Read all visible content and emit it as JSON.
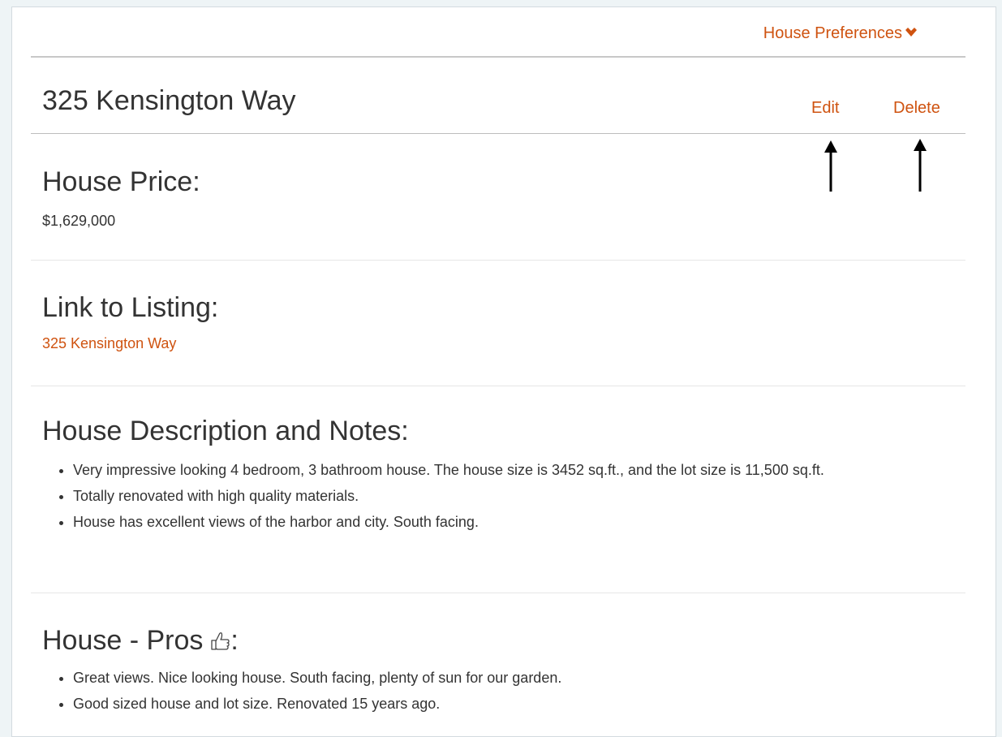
{
  "header": {
    "preferences_label": "House Preferences",
    "preferences_icon": "chevron-down-icon"
  },
  "house": {
    "title": "325 Kensington Way",
    "edit_label": "Edit",
    "delete_label": "Delete"
  },
  "price": {
    "heading": "House Price:",
    "value": "$1,629,000"
  },
  "listing": {
    "heading": "Link to Listing:",
    "link_text": "325 Kensington Way"
  },
  "description": {
    "heading": "House Description and Notes:",
    "items": [
      "Very impressive looking 4 bedroom, 3 bathroom house.  The house size is 3452 sq.ft., and the lot size is 11,500 sq.ft.",
      "Totally renovated with high quality materials.",
      "House has excellent views of the harbor and city.  South facing."
    ]
  },
  "pros": {
    "heading_prefix": "House - Pros",
    "heading_suffix": ":",
    "icon": "thumbs-up-icon",
    "items": [
      "Great views.  Nice looking house.  South facing, plenty of sun for our garden.",
      "Good sized house and lot size.  Renovated 15 years ago."
    ]
  },
  "colors": {
    "accent": "#cf5310",
    "text": "#333333",
    "background": "#eef4f6"
  }
}
